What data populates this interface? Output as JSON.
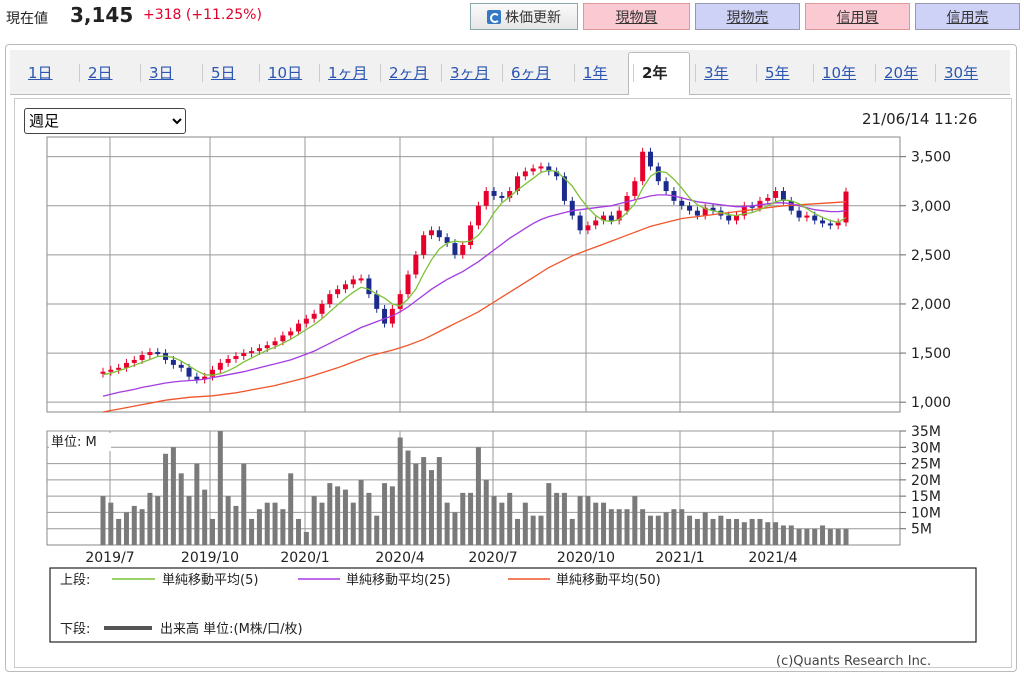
{
  "header": {
    "price_label": "現在値",
    "price_value": "3,145",
    "price_change": "+318 (+11.25%)",
    "buttons": [
      "株価更新",
      "現物買",
      "現物売",
      "信用買",
      "信用売"
    ]
  },
  "tabs": [
    "1日",
    "2日",
    "3日",
    "5日",
    "10日",
    "1ヶ月",
    "2ヶ月",
    "3ヶ月",
    "6ヶ月",
    "1年",
    "2年",
    "3年",
    "5年",
    "10年",
    "20年",
    "30年"
  ],
  "active_tab": "2年",
  "period_select": "週足",
  "timestamp": "21/06/14 11:26",
  "copyright": "(c)Quants Research Inc.",
  "colors": {
    "up": "#e8002d",
    "down": "#1b2a8c",
    "ma5": "#7cc236",
    "ma25": "#a53be0",
    "ma50": "#f0552a",
    "volume": "#7a7a7a"
  },
  "chart_data": [
    {
      "type": "candlestick",
      "interval": "weekly",
      "ylim": [
        900,
        3700
      ],
      "yticks": [
        "3,500",
        "3,000",
        "2,500",
        "2,000",
        "1,500",
        "1,000"
      ],
      "ytick_values": [
        3500,
        3000,
        2500,
        2000,
        1500,
        1000
      ],
      "xticks": [
        "2019/7",
        "2019/10",
        "2020/1",
        "2020/4",
        "2020/7",
        "2020/10",
        "2021/1",
        "2021/4"
      ],
      "close": [
        1310,
        1330,
        1350,
        1400,
        1430,
        1480,
        1510,
        1500,
        1430,
        1380,
        1350,
        1260,
        1230,
        1260,
        1330,
        1400,
        1440,
        1470,
        1500,
        1520,
        1550,
        1580,
        1620,
        1680,
        1720,
        1800,
        1850,
        1900,
        2000,
        2100,
        2150,
        2200,
        2250,
        2260,
        2100,
        1950,
        1800,
        1950,
        2100,
        2300,
        2500,
        2700,
        2750,
        2680,
        2620,
        2500,
        2600,
        2800,
        3000,
        3150,
        3100,
        3080,
        3150,
        3300,
        3350,
        3380,
        3400,
        3350,
        3300,
        3050,
        2900,
        2750,
        2800,
        2850,
        2900,
        2850,
        2950,
        3100,
        3250,
        3550,
        3400,
        3250,
        3150,
        3050,
        3000,
        2950,
        2900,
        2980,
        2950,
        2900,
        2850,
        2900,
        3000,
        2980,
        3050,
        3080,
        3150,
        3050,
        2950,
        2880,
        2900,
        2850,
        2820,
        2800,
        2830,
        3145
      ],
      "ma5": [
        1280,
        1295,
        1320,
        1345,
        1375,
        1405,
        1435,
        1465,
        1470,
        1455,
        1420,
        1370,
        1320,
        1280,
        1275,
        1290,
        1320,
        1360,
        1410,
        1450,
        1490,
        1530,
        1560,
        1600,
        1640,
        1690,
        1740,
        1790,
        1850,
        1920,
        1990,
        2060,
        2120,
        2170,
        2150,
        2100,
        2060,
        2000,
        1980,
        2050,
        2150,
        2310,
        2450,
        2560,
        2620,
        2640,
        2630,
        2640,
        2700,
        2800,
        2930,
        3030,
        3090,
        3160,
        3220,
        3280,
        3340,
        3360,
        3350,
        3280,
        3200,
        3080,
        2980,
        2900,
        2850,
        2840,
        2860,
        2930,
        3020,
        3180,
        3300,
        3350,
        3340,
        3270,
        3180,
        3080,
        3010,
        2970,
        2950,
        2930,
        2910,
        2900,
        2920,
        2930,
        2960,
        3000,
        3040,
        3060,
        3050,
        3020,
        2970,
        2920,
        2880,
        2850,
        2830,
        2880
      ],
      "ma25": [
        1060,
        1080,
        1100,
        1115,
        1130,
        1150,
        1165,
        1180,
        1195,
        1205,
        1215,
        1220,
        1225,
        1235,
        1250,
        1265,
        1280,
        1295,
        1310,
        1330,
        1350,
        1370,
        1390,
        1410,
        1430,
        1460,
        1490,
        1520,
        1560,
        1600,
        1640,
        1680,
        1720,
        1760,
        1790,
        1820,
        1850,
        1880,
        1920,
        1970,
        2030,
        2090,
        2150,
        2200,
        2250,
        2290,
        2330,
        2380,
        2430,
        2490,
        2550,
        2610,
        2670,
        2720,
        2770,
        2820,
        2860,
        2890,
        2910,
        2930,
        2950,
        2960,
        2970,
        2980,
        2990,
        3000,
        3020,
        3040,
        3060,
        3080,
        3100,
        3110,
        3110,
        3100,
        3080,
        3060,
        3040,
        3030,
        3020,
        3010,
        3000,
        2990,
        2990,
        3000,
        3010,
        3020,
        3030,
        3030,
        3020,
        3000,
        2980,
        2960,
        2950,
        2940,
        2940,
        2950
      ],
      "ma50": [
        900,
        915,
        930,
        945,
        960,
        975,
        990,
        1005,
        1020,
        1030,
        1040,
        1050,
        1055,
        1060,
        1065,
        1075,
        1085,
        1095,
        1110,
        1125,
        1140,
        1155,
        1170,
        1190,
        1210,
        1230,
        1250,
        1275,
        1300,
        1325,
        1350,
        1380,
        1410,
        1440,
        1470,
        1490,
        1510,
        1530,
        1555,
        1580,
        1610,
        1640,
        1680,
        1720,
        1760,
        1800,
        1840,
        1880,
        1920,
        1970,
        2020,
        2070,
        2120,
        2170,
        2220,
        2270,
        2320,
        2370,
        2410,
        2450,
        2490,
        2520,
        2550,
        2580,
        2610,
        2640,
        2670,
        2700,
        2730,
        2760,
        2790,
        2810,
        2830,
        2850,
        2870,
        2880,
        2890,
        2900,
        2910,
        2920,
        2930,
        2940,
        2950,
        2960,
        2970,
        2980,
        2990,
        3000,
        3005,
        3010,
        3015,
        3020,
        3025,
        3030,
        3035,
        3040
      ]
    },
    {
      "type": "bar",
      "unit_label": "単位: M",
      "ylim": [
        0,
        35
      ],
      "yticks": [
        "35M",
        "30M",
        "25M",
        "20M",
        "15M",
        "10M",
        "5M"
      ],
      "ytick_values": [
        35,
        30,
        25,
        20,
        15,
        10,
        5
      ],
      "volume": [
        15,
        13,
        8,
        10,
        12,
        11,
        16,
        15,
        28,
        30,
        22,
        15,
        25,
        17,
        8,
        35,
        15,
        12,
        25,
        8,
        11,
        13,
        13,
        11,
        22,
        8,
        4,
        15,
        13,
        19,
        18,
        17,
        13,
        20,
        16,
        9,
        19,
        18,
        33,
        29,
        25,
        27,
        23,
        27,
        13,
        10,
        16,
        16,
        30,
        20,
        15,
        13,
        16,
        8,
        13,
        9,
        9,
        19,
        16,
        16,
        8,
        15,
        15,
        13,
        13,
        11,
        11,
        11,
        15,
        11,
        9,
        9,
        10,
        11,
        11,
        9,
        8,
        10,
        8,
        9,
        8,
        8,
        7,
        8,
        8,
        7,
        7,
        6,
        6,
        5,
        5,
        5,
        6,
        5,
        5,
        5
      ]
    }
  ],
  "legend": {
    "upper_label": "上段:",
    "lower_label": "下段:",
    "ma5": "単純移動平均(5)",
    "ma25": "単純移動平均(25)",
    "ma50": "単純移動平均(50)",
    "volume": "出来高 単位:(M株/口/枚)"
  }
}
